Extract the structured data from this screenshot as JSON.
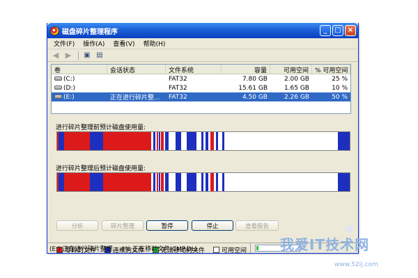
{
  "window": {
    "title": "磁盘碎片整理程序"
  },
  "menu": [
    {
      "label": "文件(F)"
    },
    {
      "label": "操作(A)"
    },
    {
      "label": "查看(V)"
    },
    {
      "label": "帮助(H)"
    }
  ],
  "list": {
    "columns": [
      "卷",
      "会话状态",
      "文件系统",
      "容量",
      "可用空间",
      "% 可用空间"
    ],
    "rows": [
      {
        "volume": "(C:)",
        "status": "",
        "fs": "FAT32",
        "capacity": "7.80 GB",
        "free": "2.00 GB",
        "pct": "25 %",
        "selected": false
      },
      {
        "volume": "(D:)",
        "status": "",
        "fs": "FAT32",
        "capacity": "15.61 GB",
        "free": "1.65 GB",
        "pct": "10 %",
        "selected": false
      },
      {
        "volume": "(E:)",
        "status": "正在进行碎片整...",
        "fs": "FAT32",
        "capacity": "4.50 GB",
        "free": "2.26 GB",
        "pct": "50 %",
        "selected": true
      }
    ]
  },
  "panels": {
    "before_label": "进行碎片整理前预计磁盘使用量:",
    "after_label": "进行碎片整理后预计磁盘使用量:"
  },
  "buttons": {
    "analyze": "分析",
    "defrag": "碎片整理",
    "pause": "暂停",
    "stop": "停止",
    "report": "查看报告"
  },
  "legend": [
    {
      "label": "零碎的文件",
      "color": "#dd1a1a"
    },
    {
      "label": "连续的文件",
      "color": "#1c2fbf"
    },
    {
      "label": "无法移动的文件",
      "color": "#2fc23a"
    },
    {
      "label": "可用空间",
      "color": "#ffffff"
    }
  ],
  "status": {
    "text": "(E:) 正在进行碎片整理...  4%  正在移动文件ICMP.DLL",
    "progress_fraction": 0.04
  },
  "colors": {
    "fragmented": "#dd1a1a",
    "contiguous": "#1c2fbf",
    "free": "#ffffff",
    "selection": "#316ac5"
  },
  "watermark": {
    "title": "我爱IT技术网",
    "url": "www.52ij.com"
  }
}
